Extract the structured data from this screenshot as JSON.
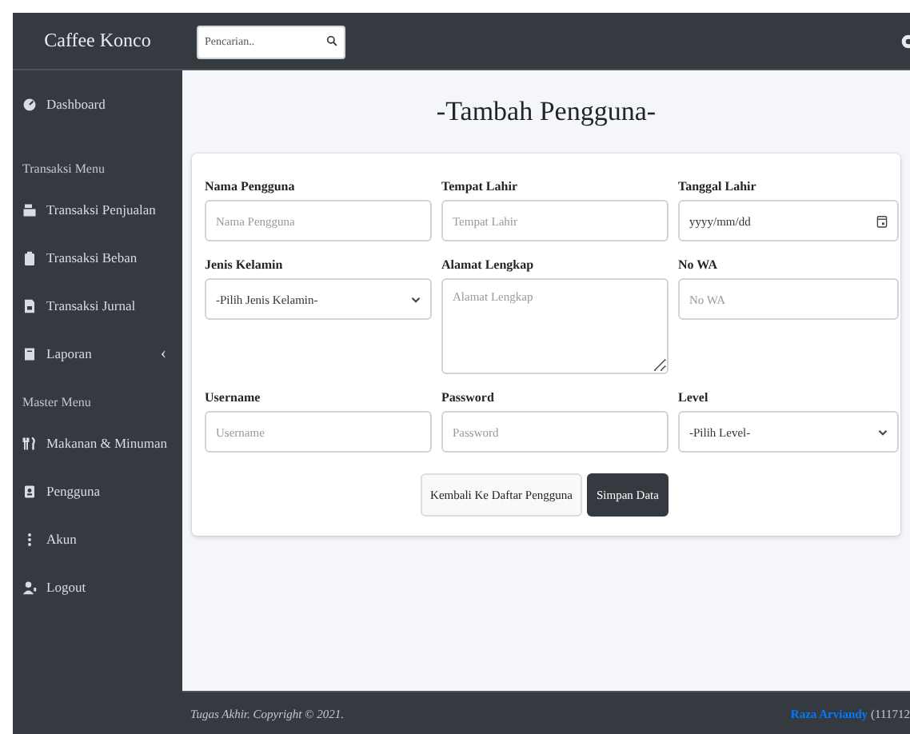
{
  "brand": "Caffee Konco",
  "search": {
    "placeholder": "Pencarian.."
  },
  "sidebar": {
    "items": [
      {
        "kind": "link",
        "label": "Dashboard"
      },
      {
        "kind": "heading",
        "label": "Transaksi Menu"
      },
      {
        "kind": "link",
        "label": "Transaksi Penjualan"
      },
      {
        "kind": "link",
        "label": "Transaksi Beban"
      },
      {
        "kind": "link",
        "label": "Transaksi Jurnal"
      },
      {
        "kind": "link",
        "label": "Laporan",
        "caret": "‹"
      },
      {
        "kind": "heading",
        "label": "Master Menu"
      },
      {
        "kind": "link",
        "label": "Makanan & Minuman"
      },
      {
        "kind": "link",
        "label": "Pengguna"
      },
      {
        "kind": "link",
        "label": "Akun"
      },
      {
        "kind": "link",
        "label": "Logout"
      }
    ]
  },
  "page_title": "-Tambah Pengguna-",
  "form": {
    "fields": [
      {
        "kind": "text",
        "label": "Nama Pengguna",
        "placeholder": "Nama Pengguna"
      },
      {
        "kind": "text",
        "label": "Tempat Lahir",
        "placeholder": "Tempat Lahir"
      },
      {
        "kind": "date",
        "label": "Tanggal Lahir",
        "value": "yyyy/mm/dd"
      },
      {
        "kind": "select",
        "label": "Jenis Kelamin",
        "value": "-Pilih Jenis Kelamin-"
      },
      {
        "kind": "textarea",
        "label": "Alamat Lengkap",
        "placeholder": "Alamat Lengkap"
      },
      {
        "kind": "text",
        "label": "No WA",
        "placeholder": "No WA"
      },
      {
        "kind": "text",
        "label": "Username",
        "placeholder": "Username"
      },
      {
        "kind": "text",
        "label": "Password",
        "placeholder": "Password"
      },
      {
        "kind": "select",
        "label": "Level",
        "value": "-Pilih Level-"
      }
    ],
    "buttons": [
      {
        "kind": "secondary",
        "label": "Kembali Ke Daftar Pengguna"
      },
      {
        "kind": "primary",
        "label": "Simpan Data"
      }
    ]
  },
  "footer": {
    "copyright": "Tugas Akhir. Copyright © 2021.",
    "author": "Raza Arviandy",
    "author_suffix": "(111712"
  }
}
